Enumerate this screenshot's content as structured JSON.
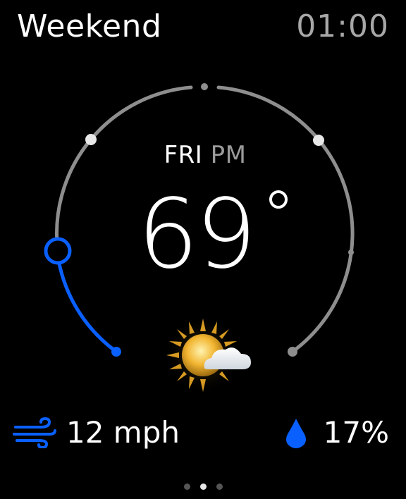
{
  "header": {
    "title": "Weekend",
    "time": "01:00"
  },
  "forecast": {
    "day": "FRI",
    "period": "PM",
    "temperature": "69",
    "condition_icon": "partly-cloudy-sun-icon"
  },
  "footer": {
    "wind_icon": "wind-icon",
    "wind": "12 mph",
    "precip_icon": "raindrop-icon",
    "precip": "17%"
  },
  "pager": {
    "pages": 3,
    "active": 1
  },
  "colors": {
    "accent": "#0a60ff",
    "track": "#8e8e8e",
    "background": "#000000",
    "secondary_text": "#a7a7a7"
  }
}
